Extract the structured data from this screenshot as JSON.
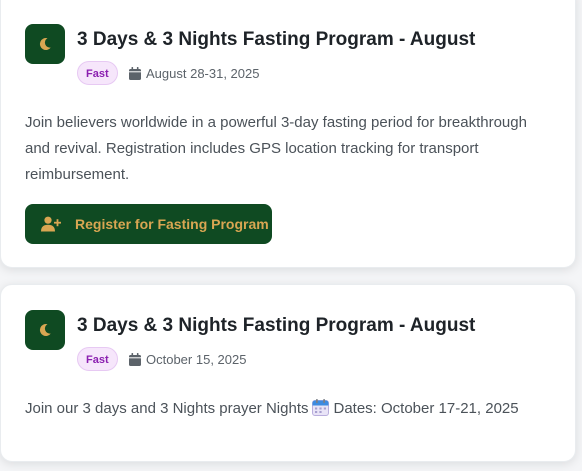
{
  "events": [
    {
      "title": "3 Days & 3 Nights Fasting Program - August",
      "badge": "Fast",
      "date": "August 28-31, 2025",
      "description": "Join believers worldwide in a powerful 3-day fasting period for breakthrough and revival. Registration includes GPS location tracking for transport reimbursement.",
      "button_label": "Register for Fasting Program",
      "icon": "moon-icon"
    },
    {
      "title": "3 Days & 3 Nights Fasting Program - August",
      "badge": "Fast",
      "date": "October 15, 2025",
      "description_before": "Join our 3 days and 3 Nights prayer Nights",
      "description_after": "Dates: October 17-21, 2025",
      "icon": "moon-icon"
    }
  ],
  "colors": {
    "brand_green": "#0f4a22",
    "accent_gold": "#d9a652",
    "badge_purple": "#8b1fb0",
    "badge_bg": "#f6e6fb"
  }
}
